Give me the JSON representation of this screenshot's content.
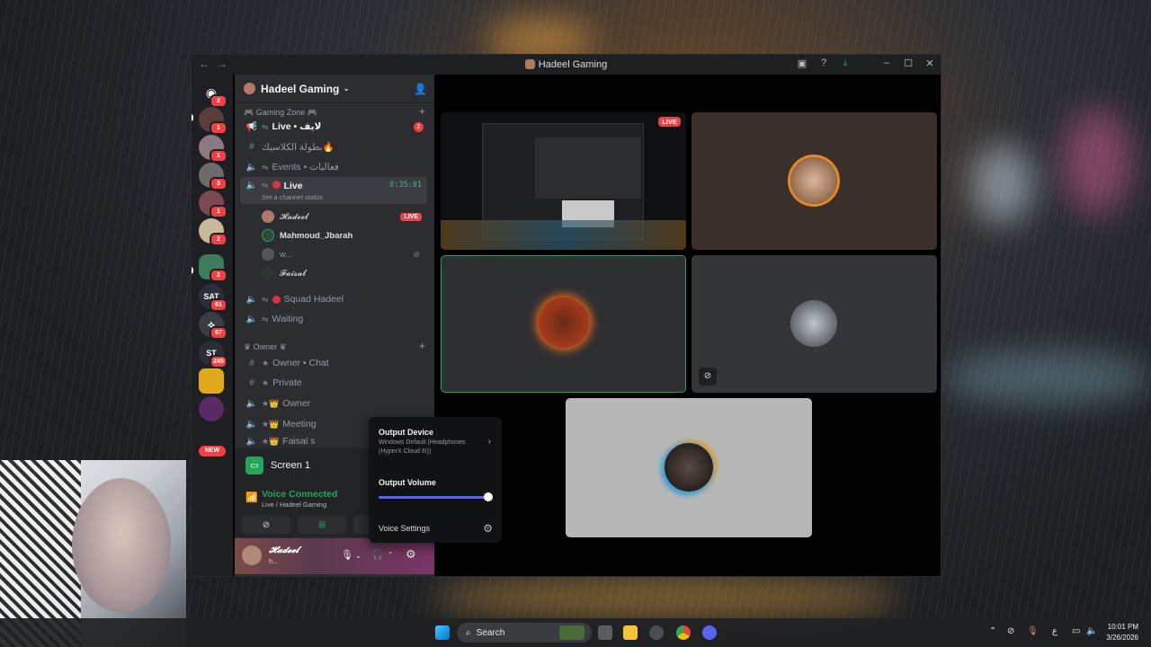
{
  "window": {
    "title": "Hadeel Gaming",
    "controls": [
      "minimize-icon",
      "maximize-icon",
      "close-icon"
    ]
  },
  "server": {
    "name": "Hadeel Gaming",
    "categories": {
      "gaming_zone": "🎮 Gaming Zone 🎮",
      "owner": "♛ Owner ♛"
    },
    "channels": {
      "live_top": "Live • لايف",
      "live_top_badge": "2",
      "sultan": "بطولة الكلاسيك🔥",
      "events": "Events • فعاليات",
      "live_active": "Live",
      "live_time": "8:35:01",
      "live_status": "Set a channel status",
      "squad": "Squad Hadeel",
      "waiting": "Waiting",
      "owner_chat": "Owner • Chat",
      "private": "Private",
      "owner": "Owner",
      "meeting": "Meeting",
      "faisal": "Faisal s"
    },
    "voice_users": [
      {
        "name": "𝓗𝓪𝓭𝓮𝓮𝓵",
        "tag": "LIVE"
      },
      {
        "name": "Mahmoud_Jbarah",
        "tag": ""
      },
      {
        "name": "w...",
        "tag": ""
      },
      {
        "name": "𝓕𝓪𝓲𝓼𝓪𝓵",
        "tag": ""
      }
    ]
  },
  "rail": {
    "badges": [
      "2",
      "1",
      "1",
      "3",
      "1",
      "2",
      "2",
      "61",
      "67",
      "245"
    ],
    "labels": [
      "SAT",
      "ST"
    ],
    "new_label": "NEW"
  },
  "screen_share": {
    "label": "Screen 1"
  },
  "voice": {
    "status": "Voice Connected",
    "channel": "Live / Hadeel Gaming"
  },
  "user": {
    "name": "𝓗𝓪𝓭𝓮𝓮𝓵",
    "status": "h..."
  },
  "popup": {
    "output_device_title": "Output Device",
    "output_device_value": "Windows Default (Headphones (HyperX Cloud III))",
    "output_volume_title": "Output Volume",
    "output_volume": 1.0,
    "voice_settings": "Voice Settings"
  },
  "grid": {
    "live_label": "LIVE"
  },
  "taskbar": {
    "search_placeholder": "Search",
    "tray_lang": "ع",
    "time": "10:01 PM",
    "date": "3/26/2026"
  },
  "colors": {
    "accent": "#5865f2",
    "green": "#23a55a",
    "red": "#ed4245"
  }
}
